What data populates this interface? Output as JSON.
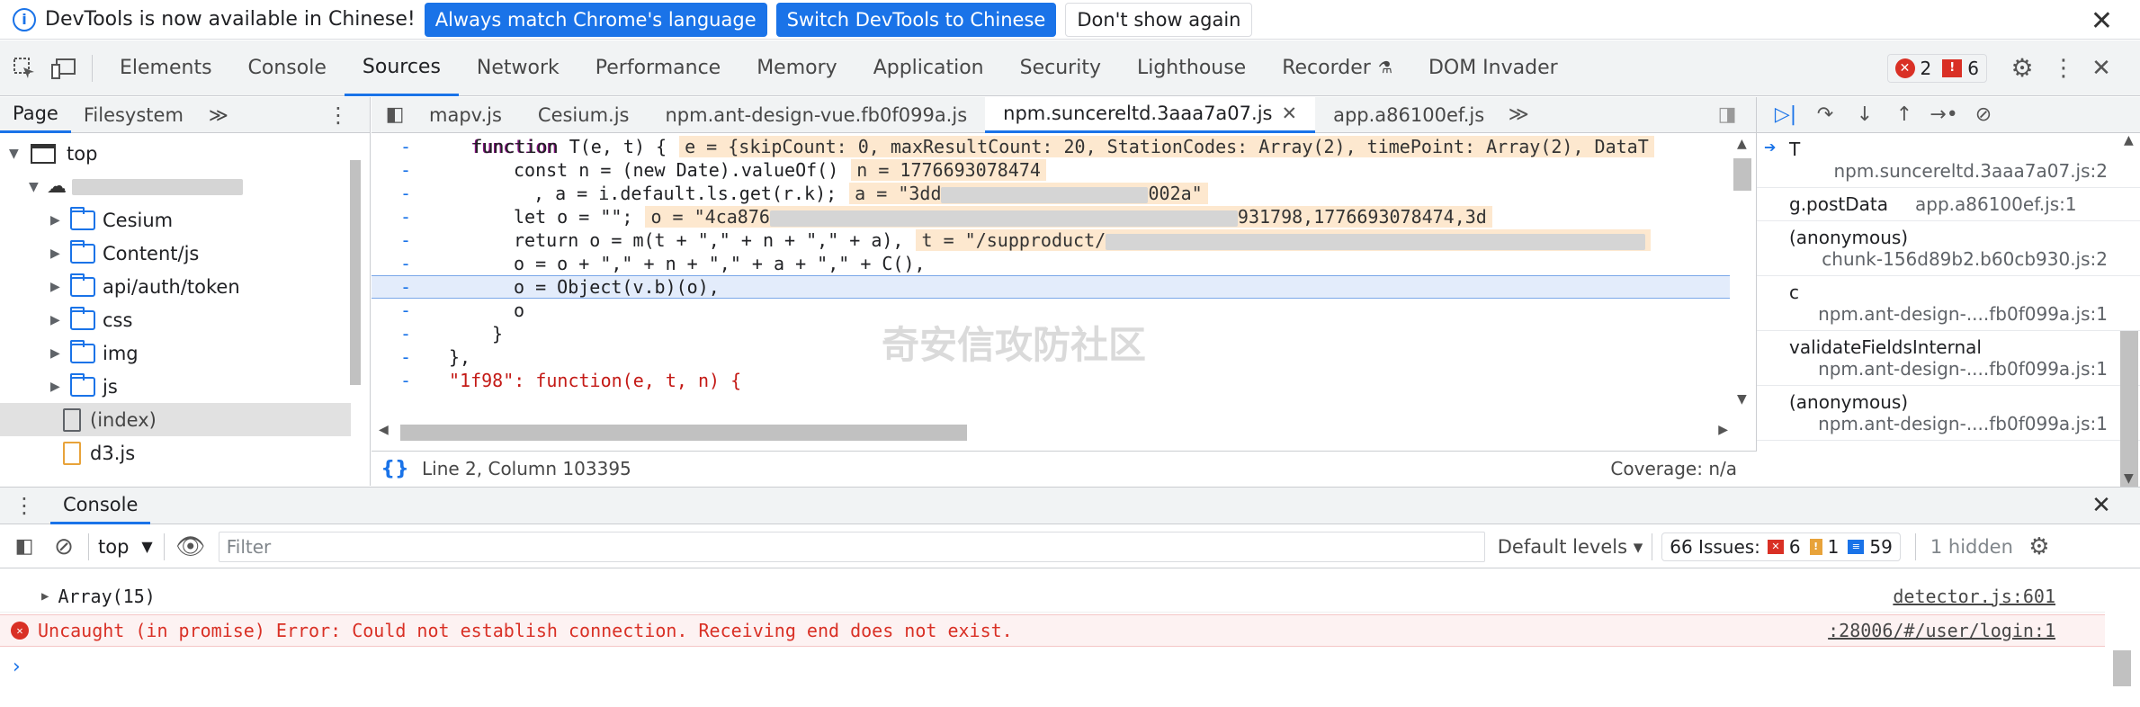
{
  "infobar": {
    "message": "DevTools is now available in Chinese!",
    "btn_match": "Always match Chrome's language",
    "btn_switch": "Switch DevTools to Chinese",
    "btn_dismiss": "Don't show again",
    "close": "✕"
  },
  "main_tabs": [
    "Elements",
    "Console",
    "Sources",
    "Network",
    "Performance",
    "Memory",
    "Application",
    "Security",
    "Lighthouse",
    "Recorder",
    "DOM Invader"
  ],
  "active_main_tab": "Sources",
  "counters": {
    "errors": "2",
    "warnings": "6"
  },
  "navigator": {
    "tabs": [
      "Page",
      "Filesystem"
    ],
    "more": "≫",
    "tree": {
      "top": "top",
      "folders": [
        "Cesium",
        "Content/js",
        "api/auth/token",
        "css",
        "img",
        "js"
      ],
      "files": [
        "(index)",
        "d3.js"
      ]
    }
  },
  "file_tabs": [
    "mapv.js",
    "Cesium.js",
    "npm.ant-design-vue.fb0f099a.js",
    "npm.suncereltd.3aaa7a07.js",
    "app.a86100ef.js"
  ],
  "active_file_tab": "npm.suncereltd.3aaa7a07.js",
  "code": {
    "l1": "function T(e, t) {",
    "l1_val": "e = {skipCount: 0, maxResultCount: 20, StationCodes: Array(2), timePoint: Array(2), DataT",
    "l2": "const n = (new Date).valueOf()",
    "l2_val": "n = 1776693078474",
    "l3": ", a = i.default.ls.get(r.k);",
    "l3_val_a": "a = \"3dd",
    "l3_val_b": "002a\"",
    "l4": "let o = \"\";",
    "l4_val_a": "o = \"4ca876",
    "l4_val_b": "931798,1776693078474,3d",
    "l5": "return o = m(t + \",\" + n + \",\" + a),",
    "l5_val": "t = \"/supproduct/",
    "l6": "o = o + \",\" + n + \",\" + a + \",\" + C(),",
    "l7": "o = Object(v.b)(o),",
    "l8": "o",
    "l9": "}",
    "l10": "},",
    "l11": "\"1f98\": function(e, t, n) {"
  },
  "status": {
    "position": "Line 2, Column 103395",
    "coverage": "Coverage: n/a"
  },
  "watermark": "奇安信攻防社区",
  "call_stack": [
    {
      "name": "T",
      "loc": "npm.suncereltd.3aaa7a07.js:2"
    },
    {
      "name": "g.postData",
      "loc": "app.a86100ef.js:1"
    },
    {
      "name": "(anonymous)",
      "loc": "chunk-156d89b2.b60cb930.js:2"
    },
    {
      "name": "c",
      "loc": "npm.ant-design-....fb0f099a.js:1"
    },
    {
      "name": "validateFieldsInternal",
      "loc": "npm.ant-design-....fb0f099a.js:1"
    },
    {
      "name": "(anonymous)",
      "loc": "npm.ant-design-....fb0f099a.js:1"
    }
  ],
  "drawer": {
    "tab": "Console"
  },
  "console_toolbar": {
    "context": "top",
    "filter_placeholder": "Filter",
    "levels": "Default levels ▾",
    "issues_label": "66 Issues:",
    "issues_err": "6",
    "issues_warn": "1",
    "issues_info": "59",
    "hidden": "1 hidden"
  },
  "console_rows": [
    {
      "text": "Array(15)",
      "src": "detector.js:601"
    },
    {
      "text": "Uncaught (in promise) Error: Could not establish connection. Receiving end does not exist.",
      "src": ":28006/#/user/login:1"
    }
  ]
}
